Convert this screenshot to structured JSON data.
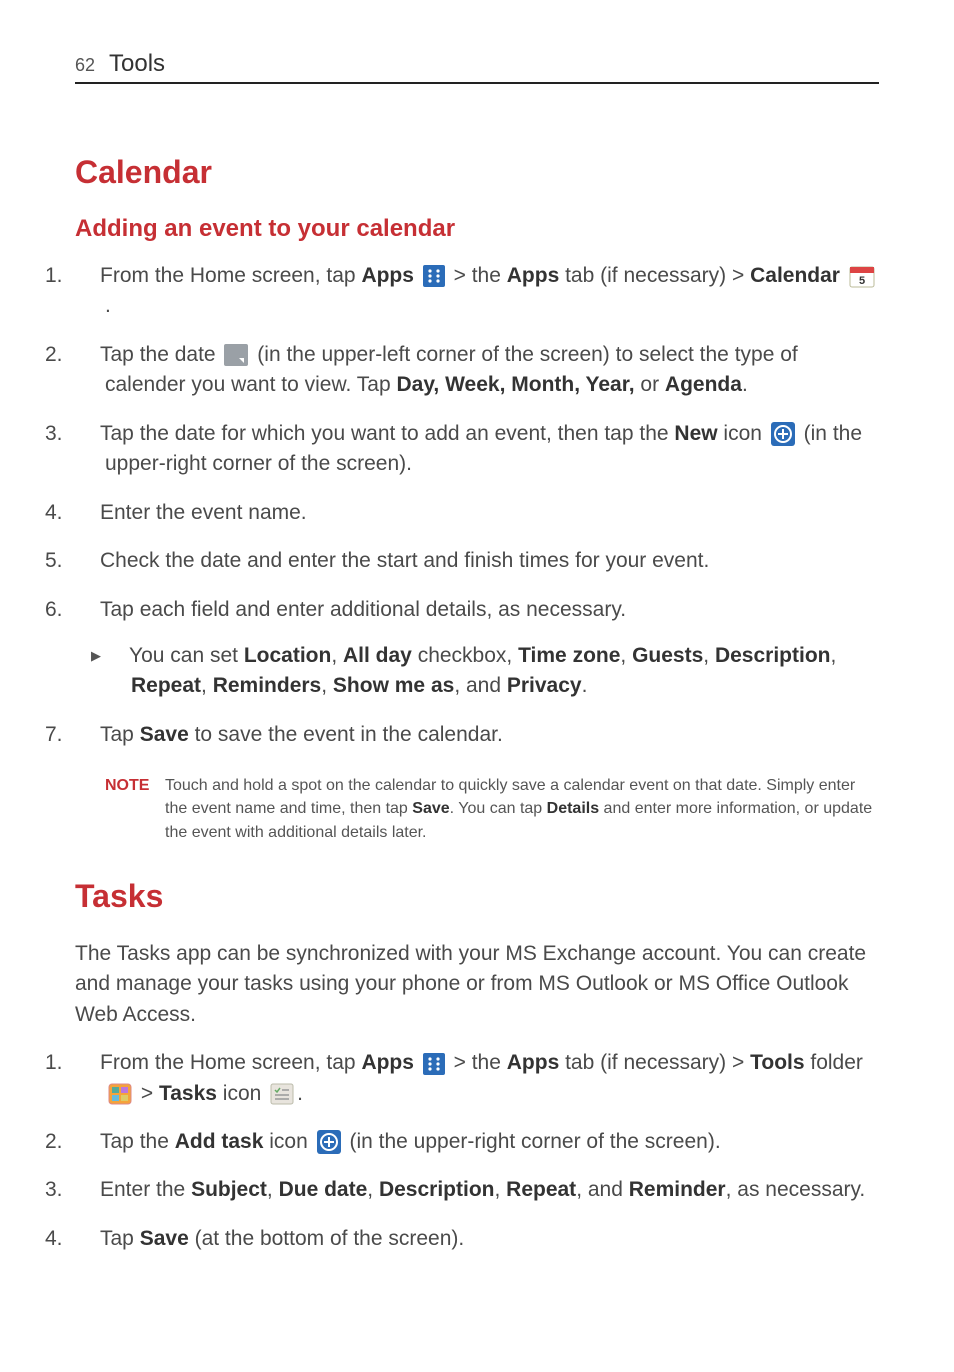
{
  "header": {
    "page_num": "62",
    "title": "Tools"
  },
  "s1": {
    "title": "Calendar",
    "sub": "Adding an event to your calendar",
    "step1_a": "From the Home screen, tap ",
    "step1_apps": "Apps",
    "step1_b": " > the ",
    "step1_apps2": "Apps",
    "step1_c": " tab (if necessary) > ",
    "step1_cal": "Calendar",
    "step1_end": ".",
    "step2_a": "Tap the date ",
    "step2_b": " (in the upper-left corner of the screen) to select the type of calender you want to view. Tap ",
    "step2_opts": "Day, Week, Month, Year,",
    "step2_or": " or ",
    "step2_ag": "Agenda",
    "step2_end": ".",
    "step3_a": "Tap the date for which you want to add an event, then tap the ",
    "step3_new": "New",
    "step3_b": " icon ",
    "step3_c": " (in the upper-right corner of the screen).",
    "step4": "Enter the event name.",
    "step5": "Check the date and enter the start and finish times for your event.",
    "step6": "Tap each field and enter additional details, as necessary.",
    "bullet_a": "You can set ",
    "b_loc": "Location",
    "b_sep1": ", ",
    "b_ad": "All day",
    "b_cb": " checkbox, ",
    "b_tz": "Time zone",
    "b_sep2": ", ",
    "b_g": "Guests",
    "b_sep3": ", ",
    "b_desc": "Description",
    "b_sep4": ", ",
    "b_rep": "Repeat",
    "b_sep5": ", ",
    "b_rem": "Reminders",
    "b_sep6": ", ",
    "b_show": "Show me as",
    "b_and": ", and ",
    "b_priv": "Privacy",
    "b_end": ".",
    "step7_a": "Tap ",
    "step7_save": "Save",
    "step7_b": " to save the event in the calendar.",
    "note_label": "NOTE",
    "note_a": "Touch and hold a spot on the calendar to quickly save a calendar event on that date. Simply enter the event name and time, then tap ",
    "note_save": "Save",
    "note_b": ". You can tap ",
    "note_det": "Details",
    "note_c": " and enter more information, or update the event with additional details later."
  },
  "s2": {
    "title": "Tasks",
    "intro": "The Tasks app can be synchronized with your MS Exchange account. You can create and manage your tasks using your phone or from MS Outlook or MS Office Outlook Web Access.",
    "step1_a": "From the Home screen, tap ",
    "step1_apps": "Apps",
    "step1_b": " > the ",
    "step1_apps2": "Apps",
    "step1_c": " tab (if necessary) > ",
    "step1_tools": "Tools",
    "step1_f": " folder ",
    "step1_gt": " > ",
    "step1_tasks": "Tasks",
    "step1_ic": " icon ",
    "step1_end": ".",
    "step2_a": "Tap the ",
    "step2_at": "Add task",
    "step2_b": " icon ",
    "step2_c": " (in the upper-right corner of the screen).",
    "step3_a": "Enter the ",
    "step3_sub": "Subject",
    "s3s1": ", ",
    "step3_due": "Due date",
    "s3s2": ", ",
    "step3_desc": "Description",
    "s3s3": ", ",
    "step3_rep": "Repeat",
    "s3and": ", and ",
    "step3_rem": "Reminder",
    "step3_b": ", as necessary.",
    "step4_a": "Tap ",
    "step4_save": "Save",
    "step4_b": " (at the bottom of the screen)."
  },
  "nums": {
    "n1": "1.",
    "n2": "2.",
    "n3": "3.",
    "n4": "4.",
    "n5": "5.",
    "n6": "6.",
    "n7": "7."
  }
}
